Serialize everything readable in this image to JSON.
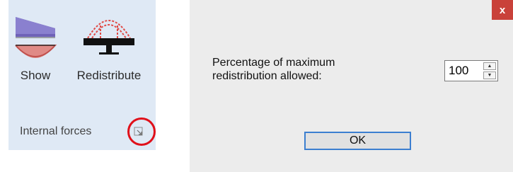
{
  "ribbon": {
    "buttons": [
      {
        "label": "Show",
        "icon": "internal-forces-diagram-icon"
      },
      {
        "label": "Redistribute",
        "icon": "redistribute-moment-icon"
      }
    ],
    "group_label": "Internal forces",
    "launcher_icon": "dialog-launcher-icon",
    "highlight_color": "#e0101a",
    "background": "#dfe9f5"
  },
  "dialog": {
    "close_label": "x",
    "prompt": "Percentage of maximum redistribution allowed:",
    "percentage_value": "100",
    "ok_label": "OK",
    "close_color": "#c9413a",
    "focus_border_color": "#3c7fd0"
  }
}
